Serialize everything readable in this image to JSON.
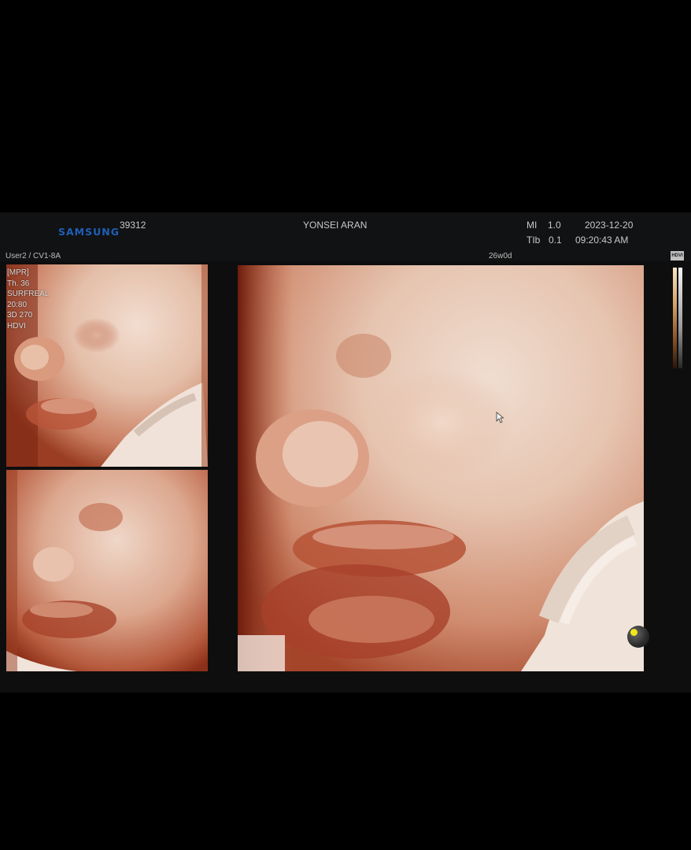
{
  "header": {
    "brand": "SAMSUNG",
    "patient_id": "39312",
    "institution": "YONSEI ARAN",
    "mi_label": "MI",
    "mi_value": "1.0",
    "tib_label": "TIb",
    "tib_value": "0.1",
    "date": "2023-12-20",
    "time": "09:20:43 AM"
  },
  "subheader": {
    "user_probe": "User2 / CV1-8A",
    "gestational_age": "26w0d"
  },
  "params": [
    "[MPR]",
    "Th. 36",
    "SURFREAL",
    "20:80",
    "3D 270",
    "HDVI"
  ],
  "side_panel": {
    "badge": "HDVI"
  },
  "icons": {
    "trackball": "trackball-indicator-icon",
    "cursor": "mouse-pointer-icon"
  },
  "colors": {
    "brand": "#1f5fb8",
    "skin_light": "#ecd3c2",
    "skin_dark": "#8a3019",
    "indicator": "#f0e61b"
  }
}
